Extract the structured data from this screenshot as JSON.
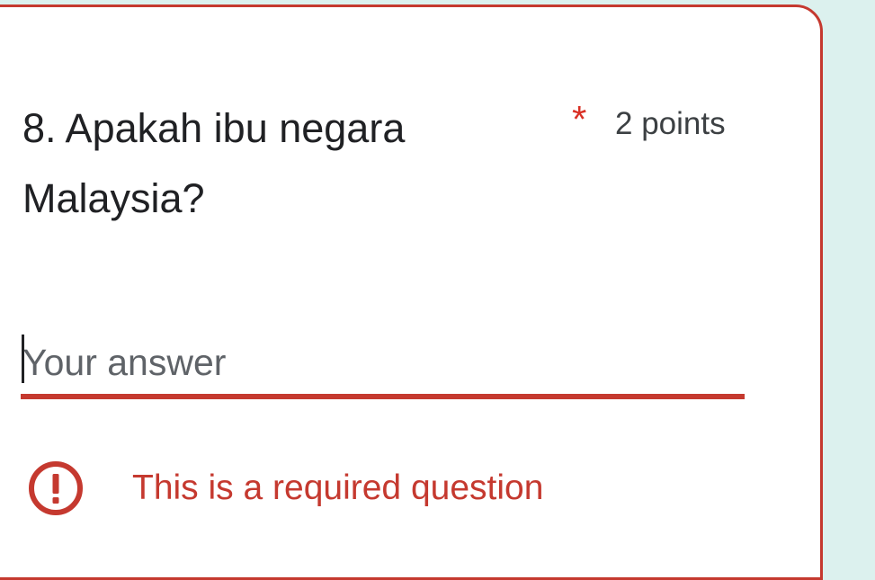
{
  "question": {
    "title": "8. Apakah ibu negara Malaysia?",
    "required_mark": "*",
    "points": "2 points"
  },
  "answer": {
    "value": "",
    "placeholder": "Your answer"
  },
  "validation": {
    "message": "This is a required question",
    "icon": "error-exclamation-icon"
  },
  "colors": {
    "error": "#c5392f",
    "required": "#d93025",
    "page_background": "#dcf1ee",
    "card_background": "#ffffff",
    "text_primary": "#202124",
    "text_secondary": "#5f6368"
  }
}
